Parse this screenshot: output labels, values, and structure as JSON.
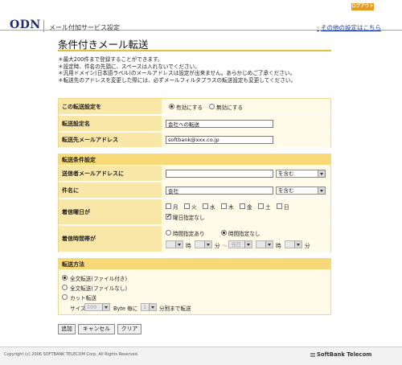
{
  "header": {
    "logout_label": "ログアウト",
    "logo": "ODN",
    "title": "メール付加サービス設定",
    "other_settings_link": "その他の設定はこちら"
  },
  "page": {
    "title": "条件付きメール転送",
    "notes": [
      "＊最大200件まで登録することができます。",
      "＊設定時、件名の先頭に、スペースは入れないでください。",
      "＊汎用ドメイン(日本語ラベル)のメールアドレスは設定が出来ません。あらかじめご了承ください。",
      "＊転送先のアドレスを変更した際には、必ずメールフィルタプラスの転送設定も変更してください。"
    ]
  },
  "basic": {
    "enable_label": "この転送設定を",
    "enable_option": "有効にする",
    "disable_option": "無効にする",
    "enabled": true,
    "name_label": "転送設定名",
    "name_value": "会社への転送",
    "dest_label": "転送先メールアドレス",
    "dest_value": "softbank@xxx.co.jp"
  },
  "conditions": {
    "section_title": "転送条件設定",
    "sender_label": "送信者メールアドレスに",
    "sender_value": "",
    "sender_match": "を含む",
    "subject_label": "件名に",
    "subject_value": "会社",
    "subject_match": "を含む",
    "weekday_label": "着信曜日が",
    "weekdays": [
      "月",
      "火",
      "水",
      "木",
      "金",
      "土",
      "日"
    ],
    "weekday_none_label": "曜日指定なし",
    "weekday_none_checked": true,
    "time_label": "着信時間帯が",
    "time_specified_option": "時間指定あり",
    "time_unspecified_option": "時間指定なし",
    "time_specified": false,
    "time_unit_hour": "時",
    "time_unit_minute": "分",
    "time_range_sep": "～",
    "day_select_value": "当日"
  },
  "method": {
    "section_title": "転送方法",
    "options": [
      "全文転送(ファイル付き)",
      "全文転送(ファイルなし)",
      "カット転送"
    ],
    "selected_index": 0,
    "size_label": "サイズ",
    "size_value": "100",
    "size_unit": "Byte 毎に",
    "split_value": "1",
    "split_suffix": "分割まで転送"
  },
  "buttons": {
    "add": "追加",
    "cancel": "キャンセル",
    "clear": "クリア"
  },
  "footer": {
    "copyright": "Copyright (c) 2006 SOFTBANK TELECOM Corp. All Rights Reserved.",
    "brand": "SoftBank Telecom"
  },
  "colors": {
    "accent": "#e79a1f",
    "label_bg": "#f8e7a6",
    "section_bg": "#f7d977",
    "link": "#1d3eb5",
    "logo": "#1a2c7a"
  }
}
